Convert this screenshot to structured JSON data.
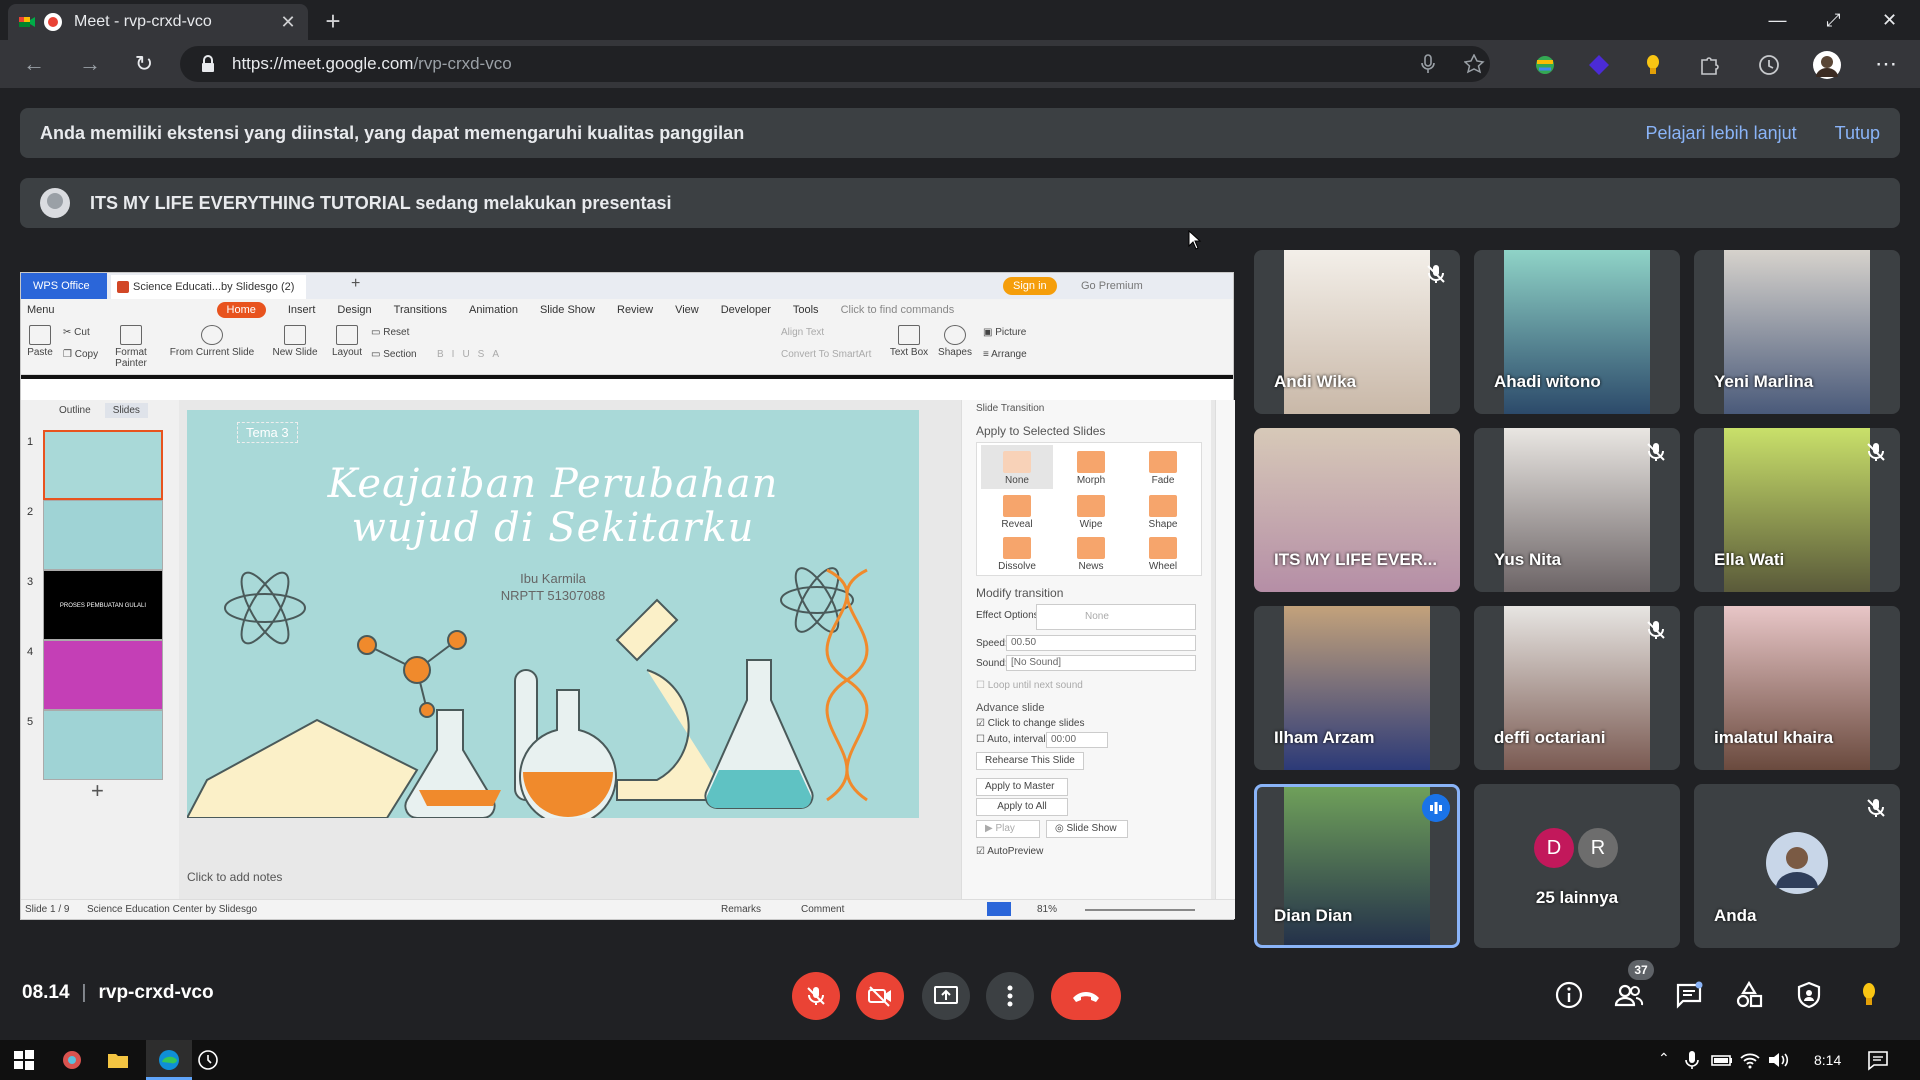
{
  "browser": {
    "tab_title": "Meet - rvp-crxd-vco",
    "tab_close": "✕",
    "new_tab": "+",
    "url_host": "https://meet.google.com",
    "url_path": "/rvp-crxd-vco",
    "win_min": "—",
    "win_restore": "⤢",
    "win_close": "✕"
  },
  "banners": {
    "extension_warning": "Anda memiliki ekstensi yang diinstal, yang dapat memengaruhi kualitas panggilan",
    "learn_more": "Pelajari lebih lanjut",
    "close": "Tutup",
    "presenting": "ITS MY LIFE EVERYTHING TUTORIAL sedang melakukan presentasi"
  },
  "wps": {
    "office_tab": "WPS Office",
    "doc_tab": "Science Educati...by Slidesgo (2)",
    "sign_in": "Sign in",
    "go_premium": "Go Premium",
    "menu": [
      "Menu",
      "Home",
      "Insert",
      "Design",
      "Transitions",
      "Animation",
      "Slide Show",
      "Review",
      "View",
      "Developer",
      "Tools"
    ],
    "find": "Click to find commands",
    "ribbon": {
      "paste": "Paste",
      "cut": "Cut",
      "copy": "Copy",
      "format_painter": "Format Painter",
      "from_current": "From Current Slide",
      "new_slide": "New Slide",
      "layout": "Layout",
      "reset": "Reset",
      "section": "Section",
      "align_text": "Align Text",
      "convert_smartart": "Convert To SmartArt",
      "text_box": "Text Box",
      "shapes": "Shapes",
      "picture": "Picture",
      "arrange": "Arrange"
    },
    "thumb_tabs": {
      "outline": "Outline",
      "slides": "Slides"
    },
    "thumb_numbers": [
      "1",
      "2",
      "3",
      "4",
      "5"
    ],
    "thumb3_text": "PROSES PEMBUATAN GULALI",
    "slide": {
      "tema": "Tema 3",
      "title_line1": "Keajaiban Perubahan",
      "title_line2": "wujud di Sekitarku",
      "author": "Ibu Karmila",
      "nrptt": "NRPTT 51307088"
    },
    "notes": "Click to add notes",
    "transition": {
      "header": "Slide Transition",
      "apply_selected": "Apply to Selected Slides",
      "effects": [
        "None",
        "Morph",
        "Fade",
        "Reveal",
        "Wipe",
        "Shape",
        "Dissolve",
        "News",
        "Wheel"
      ],
      "modify": "Modify transition",
      "effect_options_label": "Effect Options:",
      "effect_options_value": "None",
      "speed_label": "Speed:",
      "speed_value": "00.50",
      "sound_label": "Sound:",
      "sound_value": "[No Sound]",
      "loop": "Loop until next sound",
      "advance": "Advance slide",
      "click_change": "Click to change slides",
      "auto_interval": "Auto, interval:",
      "interval_value": "00:00",
      "rehearse": "Rehearse This Slide",
      "apply_master": "Apply to Master",
      "apply_all": "Apply to All",
      "play": "Play",
      "slide_show": "Slide Show",
      "autopreview": "AutoPreview"
    },
    "status": {
      "slide_of": "Slide 1 / 9",
      "theme": "Science Education Center by Slidesgo",
      "remarks": "Remarks",
      "comment": "Comment",
      "zoom": "81%"
    }
  },
  "participants": [
    {
      "name": "Andi Wika",
      "muted": true
    },
    {
      "name": "Ahadi witono",
      "muted": false
    },
    {
      "name": "Yeni Marlina",
      "muted": false
    },
    {
      "name": "ITS MY LIFE EVER...",
      "muted": false
    },
    {
      "name": "Yus Nita",
      "muted": true
    },
    {
      "name": "Ella Wati",
      "muted": true
    },
    {
      "name": "Ilham Arzam",
      "muted": false
    },
    {
      "name": "deffi octariani",
      "muted": true
    },
    {
      "name": "imalatul khaira",
      "muted": false
    },
    {
      "name": "Dian Dian",
      "muted": false,
      "speaking": true
    },
    {
      "name": "25 lainnya",
      "avatars": [
        "D",
        "R"
      ]
    },
    {
      "name": "Anda",
      "muted": true
    }
  ],
  "bottom": {
    "time": "08.14",
    "separator": "|",
    "meeting_code": "rvp-crxd-vco",
    "participant_count": "37"
  },
  "taskbar": {
    "clock": "8:14"
  },
  "colors": {
    "meet_bg": "#202124",
    "red": "#ea4335",
    "blue": "#8ab4f8",
    "wps_orange": "#e8531e",
    "slide_teal": "#a9d9d8"
  }
}
